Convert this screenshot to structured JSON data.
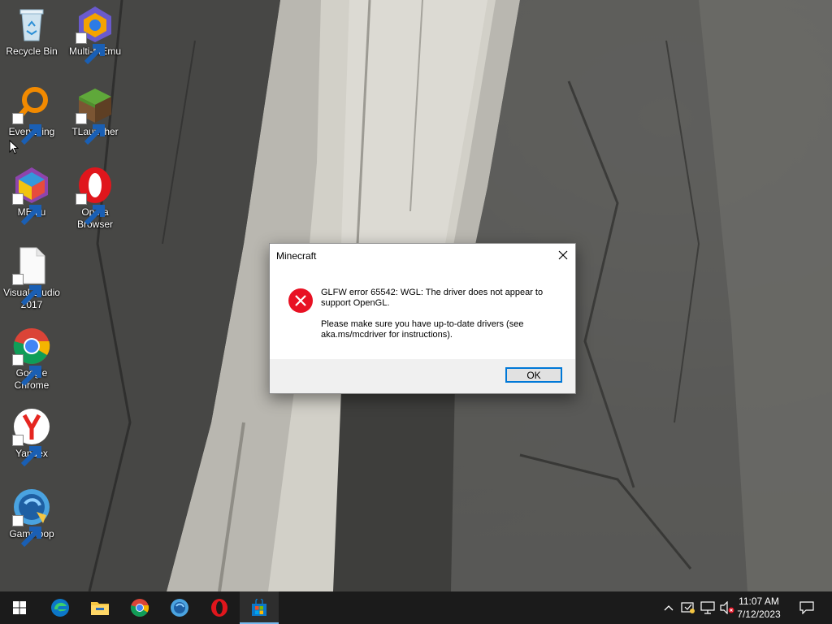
{
  "desktop": {
    "icons": [
      {
        "label": "Recycle Bin",
        "icon": "recycle-bin-icon",
        "shortcut": false
      },
      {
        "label": "Multi-MEmu",
        "icon": "multi-memu-icon",
        "shortcut": true
      },
      {
        "label": "Everything",
        "icon": "everything-search-icon",
        "shortcut": true
      },
      {
        "label": "TLauncher",
        "icon": "tlauncher-grass-block-icon",
        "shortcut": true
      },
      {
        "label": "MEmu",
        "icon": "memu-icon",
        "shortcut": true
      },
      {
        "label": "Opera Browser",
        "icon": "opera-icon",
        "shortcut": true
      },
      {
        "label": "Visual Studio 2017",
        "icon": "blank-file-icon",
        "shortcut": true
      },
      {
        "label": "Google Chrome",
        "icon": "chrome-icon",
        "shortcut": true
      },
      {
        "label": "Yandex",
        "icon": "yandex-icon",
        "shortcut": true
      },
      {
        "label": "Gameloop",
        "icon": "gameloop-icon",
        "shortcut": true
      }
    ]
  },
  "dialog": {
    "title": "Minecraft",
    "message_line1": "GLFW error 65542: WGL: The driver does not appear to support OpenGL.",
    "message_line2": "Please make sure you have up-to-date drivers (see aka.ms/mcdriver for instructions).",
    "ok_label": "OK",
    "icon": "error-icon"
  },
  "taskbar": {
    "items": [
      {
        "name": "start",
        "icon": "windows-start-icon"
      },
      {
        "name": "edge",
        "icon": "edge-icon"
      },
      {
        "name": "file-explorer",
        "icon": "folder-icon"
      },
      {
        "name": "chrome",
        "icon": "chrome-icon"
      },
      {
        "name": "memu",
        "icon": "memu-icon"
      },
      {
        "name": "opera",
        "icon": "opera-icon"
      },
      {
        "name": "store",
        "icon": "store-icon",
        "active": true
      }
    ],
    "time": "11:07 AM",
    "date": "7/12/2023",
    "accent": "#76b9ed"
  },
  "colors": {
    "error_red": "#e81123",
    "button_border": "#0078d7",
    "taskbar_bg": "#1b1b1b"
  }
}
